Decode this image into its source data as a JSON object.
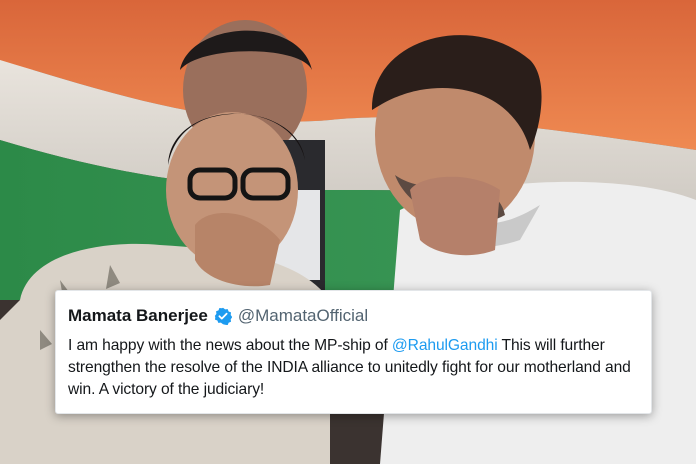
{
  "tweet": {
    "author_name": "Mamata Banerjee",
    "handle": "@MamataOfficial",
    "verified_icon": "verified-badge-icon",
    "text_part1": "I am happy with the news about the MP-ship of",
    "mention": "@RahulGandhi",
    "text_part2": "This will further strengthen the resolve of the INDIA alliance to unitedly fight for our motherland and win. A victory of the judiciary!"
  },
  "colors": {
    "mention": "#1d9bf0",
    "verified": "#1d9bf0",
    "flag_saffron": "#e8773e",
    "flag_green": "#2e8b4a"
  }
}
